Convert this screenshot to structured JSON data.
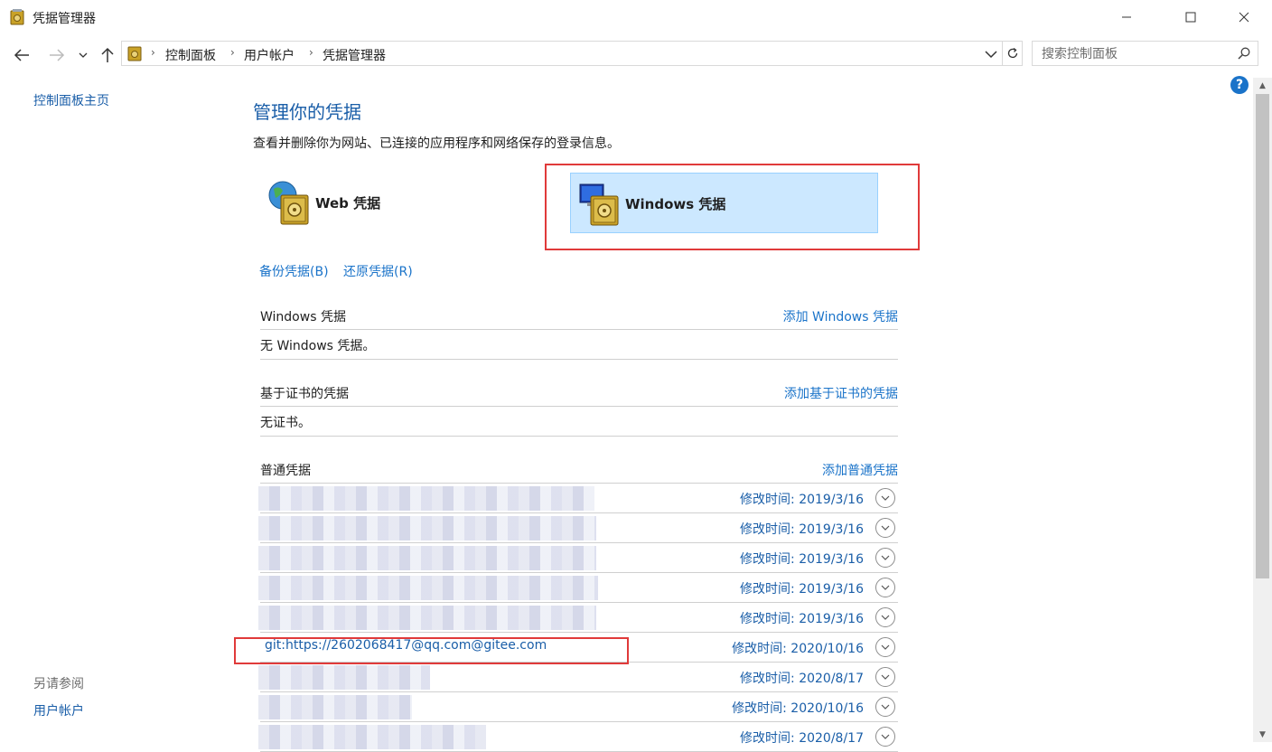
{
  "window": {
    "title": "凭据管理器",
    "controls": {
      "minimize": "—",
      "maximize": "☐",
      "close": "✕"
    }
  },
  "nav": {
    "back": "←",
    "forward": "→",
    "recent": "⌄",
    "up": "↑",
    "breadcrumb": [
      "控制面板",
      "用户帐户",
      "凭据管理器"
    ],
    "search_placeholder": "搜索控制面板"
  },
  "sidebar": {
    "home_link": "控制面板主页",
    "see_also_heading": "另请参阅",
    "see_also_link": "用户帐户"
  },
  "help": "?",
  "main": {
    "title": "管理你的凭据",
    "description": "查看并删除你为网站、已连接的应用程序和网络保存的登录信息。",
    "tiles": [
      {
        "label": "Web 凭据",
        "icon": "globe-safe-icon",
        "selected": false
      },
      {
        "label": "Windows 凭据",
        "icon": "computer-safe-icon",
        "selected": true
      }
    ],
    "backup_link": "备份凭据(B)",
    "restore_link": "还原凭据(R)",
    "sections": {
      "windows": {
        "title": "Windows 凭据",
        "add": "添加 Windows 凭据",
        "empty": "无 Windows 凭据。"
      },
      "certificate": {
        "title": "基于证书的凭据",
        "add": "添加基于证书的凭据",
        "empty": "无证书。"
      },
      "generic": {
        "title": "普通凭据",
        "add": "添加普通凭据"
      }
    },
    "generic_rows": [
      {
        "name": "",
        "modified": "修改时间:  2019/3/16"
      },
      {
        "name": "",
        "modified": "修改时间:  2019/3/16"
      },
      {
        "name": "",
        "modified": "修改时间:  2019/3/16"
      },
      {
        "name": "",
        "modified": "修改时间:  2019/3/16"
      },
      {
        "name": "",
        "modified": "修改时间:  2019/3/16"
      },
      {
        "name": "git:https://2602068417@qq.com@gitee.com",
        "modified": "修改时间:  2020/10/16"
      },
      {
        "name": "",
        "modified": "修改时间:  2020/8/17"
      },
      {
        "name": "",
        "modified": "修改时间:  2020/10/16"
      },
      {
        "name": "",
        "modified": "修改时间:  2020/8/17"
      }
    ]
  },
  "colors": {
    "link": "#1a73c9",
    "selected_tile": "#cce8ff",
    "highlight_box": "#e03a3a"
  }
}
